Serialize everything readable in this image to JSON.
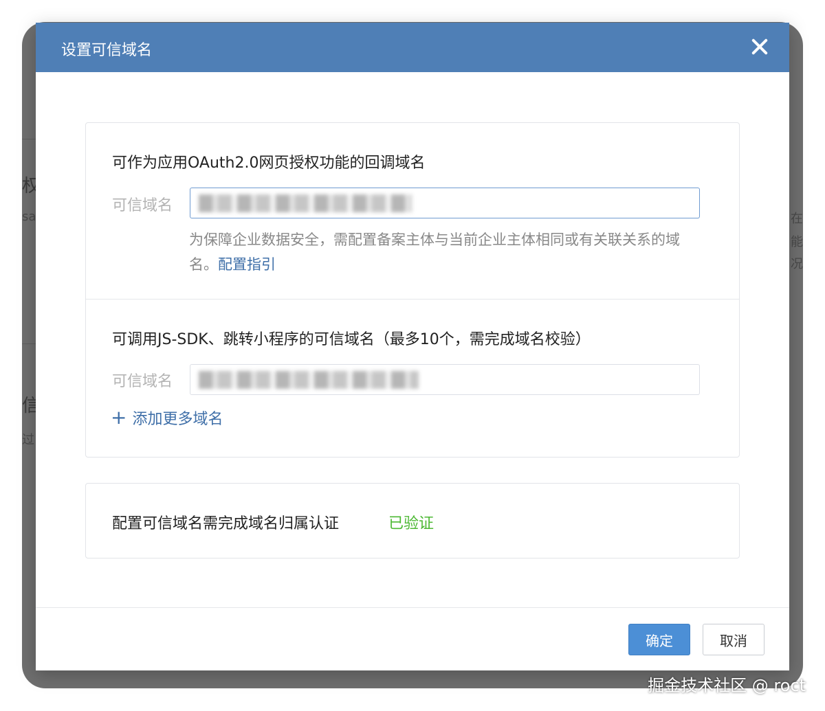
{
  "background": {
    "fragments": [
      "权",
      "sa",
      "信",
      "过",
      "在",
      "能",
      "况"
    ]
  },
  "modal": {
    "title": "设置可信域名",
    "close_icon": "close-icon",
    "oauth_section": {
      "title": "可作为应用OAuth2.0网页授权功能的回调域名",
      "field_label": "可信域名",
      "field_value": "",
      "hint_text": "为保障企业数据安全，需配置备案主体与当前企业主体相同或有关联关系的域名。",
      "hint_link": "配置指引"
    },
    "jssdk_section": {
      "title": "可调用JS-SDK、跳转小程序的可信域名（最多10个，需完成域名校验）",
      "field_label": "可信域名",
      "field_value": "",
      "add_more_label": "添加更多域名"
    },
    "certification": {
      "label": "配置可信域名需完成域名归属认证",
      "status": "已验证",
      "status_color": "#4cb833"
    },
    "buttons": {
      "confirm": "确定",
      "cancel": "取消"
    }
  },
  "watermark": "掘金技术社区 @ roct",
  "colors": {
    "header": "#4f7fb6",
    "primary_button": "#4c8fd6",
    "link": "#3f6fa8"
  }
}
